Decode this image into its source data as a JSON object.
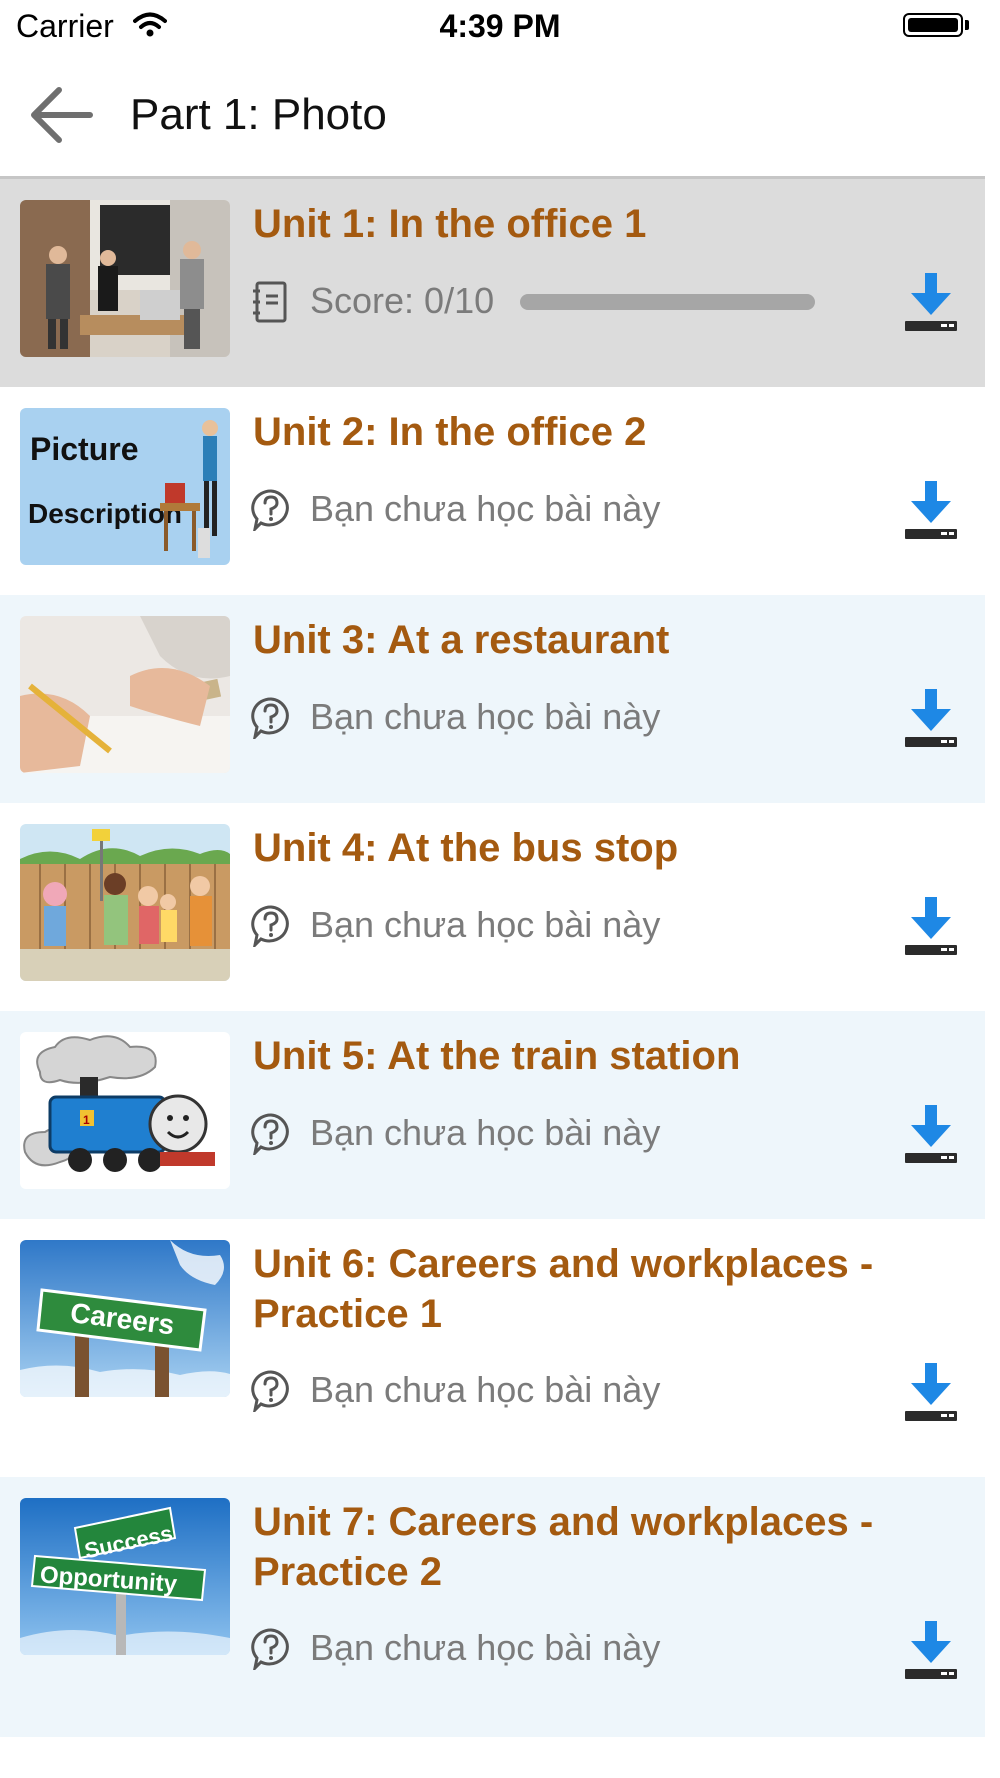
{
  "status_bar": {
    "carrier": "Carrier",
    "time": "4:39 PM"
  },
  "nav": {
    "title": "Part 1: Photo"
  },
  "units": [
    {
      "title": "Unit 1: In the office 1",
      "status": "Score: 0/10",
      "progress": 0,
      "status_icon": "notebook-icon",
      "thumb": "office-photo"
    },
    {
      "title": "Unit 2: In the office 2",
      "status": "Bạn chưa học bài này",
      "status_icon": "question-icon",
      "thumb": "picture-description"
    },
    {
      "title": "Unit 3: At a restaurant",
      "status": "Bạn chưa học bài này",
      "status_icon": "question-icon",
      "thumb": "writing-hand"
    },
    {
      "title": "Unit 4: At the bus stop",
      "status": "Bạn chưa học bài này",
      "status_icon": "question-icon",
      "thumb": "bus-stop-cartoon"
    },
    {
      "title": "Unit 5: At the train station",
      "status": "Bạn chưa học bài này",
      "status_icon": "question-icon",
      "thumb": "train-cartoon"
    },
    {
      "title": "Unit 6: Careers and workplaces - Practice 1",
      "status": "Bạn chưa học bài này",
      "status_icon": "question-icon",
      "thumb": "careers-sign"
    },
    {
      "title": "Unit 7: Careers and workplaces - Practice 2",
      "status": "Bạn chưa học bài này",
      "status_icon": "question-icon",
      "thumb": "success-opportunity-sign"
    }
  ],
  "colors": {
    "title": "#a45a10",
    "download": "#1e88e5",
    "highlight_row": "#dcdcdc",
    "alt_row": "#eef6fb"
  }
}
